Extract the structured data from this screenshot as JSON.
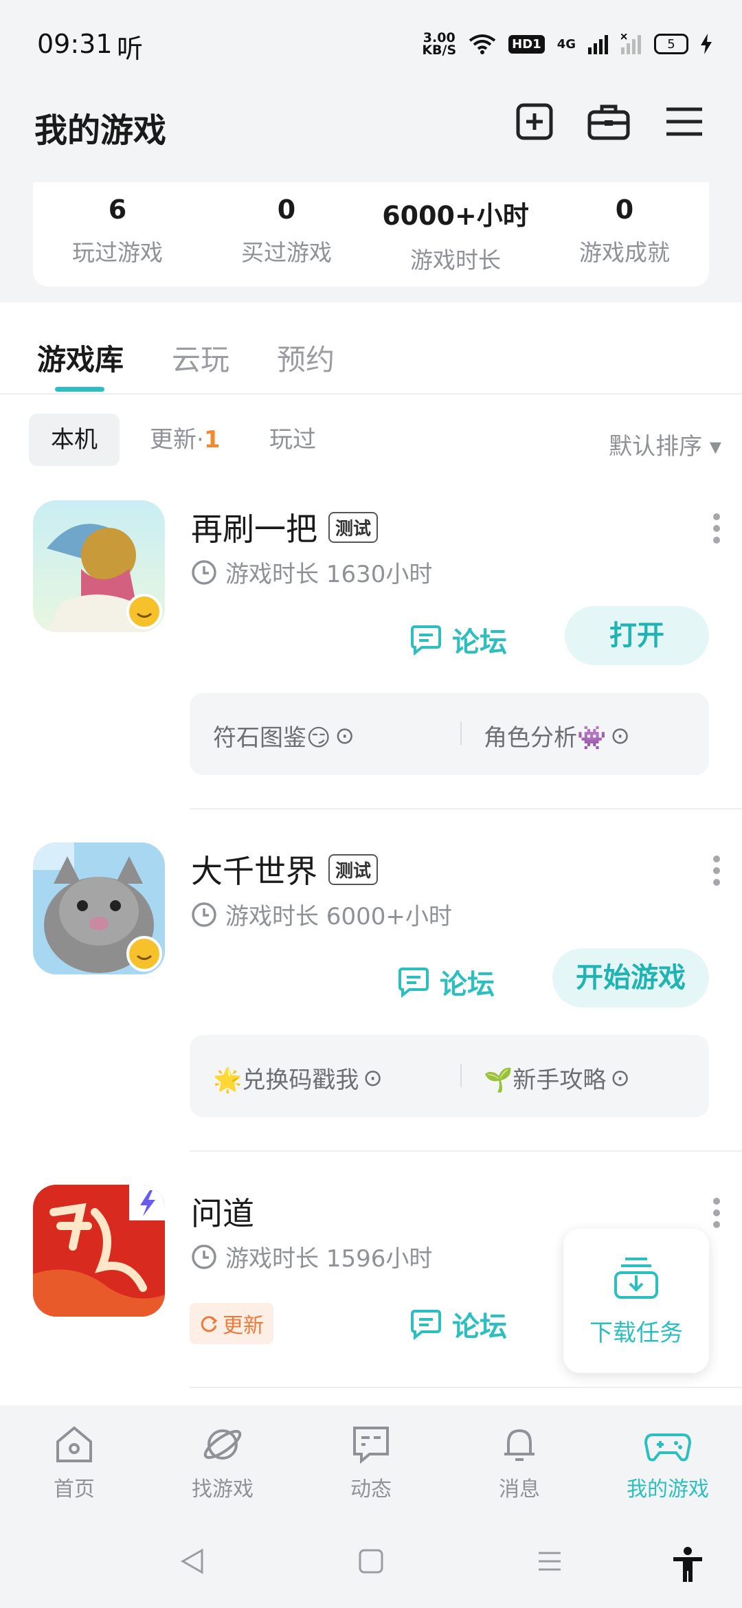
{
  "status_bar": {
    "time": "09:31",
    "extra": "听",
    "speed_top": "3.00",
    "speed_bottom": "KB/S",
    "hd": "HD1",
    "net": "4G",
    "battery": "5"
  },
  "header": {
    "title": "我的游戏"
  },
  "stats": [
    {
      "value": "6",
      "label": "玩过游戏"
    },
    {
      "value": "0",
      "label": "买过游戏"
    },
    {
      "value": "6000+小时",
      "label": "游戏时长"
    },
    {
      "value": "0",
      "label": "游戏成就"
    }
  ],
  "tabs": [
    "游戏库",
    "云玩",
    "预约"
  ],
  "filters": {
    "local": "本机",
    "updates": "更新·",
    "updates_count": "1",
    "played": "玩过",
    "sort": "默认排序 ▾"
  },
  "games": [
    {
      "name": "再刷一把",
      "badge": "测试",
      "time": "游戏时长 1630小时",
      "forum": "论坛",
      "action": "打开",
      "links": [
        "符石图鉴😏",
        "角色分析👾"
      ]
    },
    {
      "name": "大千世界",
      "badge": "测试",
      "time": "游戏时长 6000+小时",
      "forum": "论坛",
      "action": "开始游戏",
      "links": [
        "🌟兑换码戳我",
        "🌱新手攻略"
      ]
    },
    {
      "name": "问道",
      "time": "游戏时长 1596小时",
      "update": "更新",
      "forum": "论坛"
    }
  ],
  "fab": {
    "label": "下载任务"
  },
  "bottom_nav": [
    "首页",
    "找游戏",
    "动态",
    "消息",
    "我的游戏"
  ],
  "colors": {
    "accent": "#2dbfbf",
    "update": "#f08a30"
  }
}
